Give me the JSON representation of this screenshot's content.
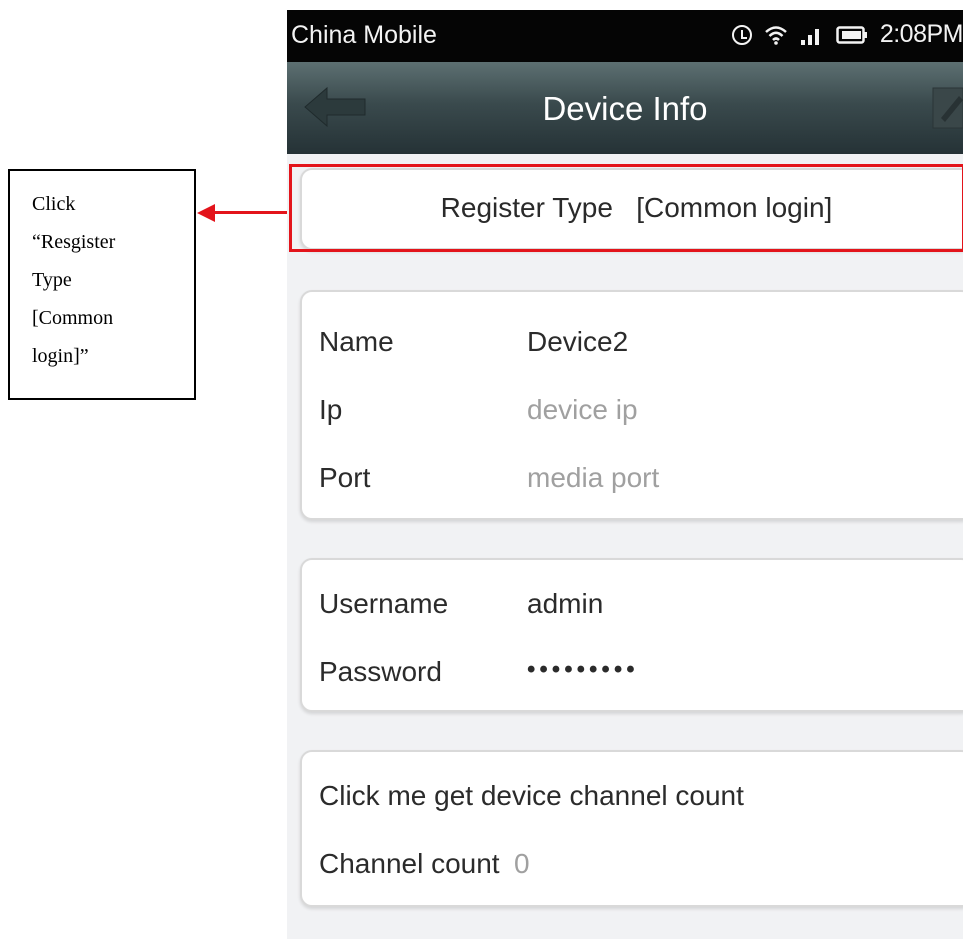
{
  "annotation": {
    "lines": [
      "Click",
      "“Resgister",
      "Type",
      "[Common",
      "login]”"
    ],
    "arrow_color": "#e3141b"
  },
  "statusbar": {
    "carrier": "China Mobile",
    "time": "2:08PM",
    "icons": [
      "alarm-icon",
      "wifi-icon",
      "signal-icon",
      "battery-icon"
    ]
  },
  "titlebar": {
    "title": "Device Info",
    "left_icon": "back-arrow-icon",
    "right_icon": "edit-icon"
  },
  "register": {
    "label": "Register Type",
    "value": "[Common login]",
    "text": "Register Type   [Common login]",
    "highlight_color": "#e3141b"
  },
  "device": {
    "name_label": "Name",
    "name_value": "Device2",
    "ip_label": "Ip",
    "ip_placeholder": "device ip",
    "port_label": "Port",
    "port_placeholder": "media port"
  },
  "credentials": {
    "username_label": "Username",
    "username_value": "admin",
    "password_label": "Password",
    "password_value": "•••••••••"
  },
  "channel": {
    "get_button": "Click me get device channel count",
    "count_label": "Channel count",
    "count_value": "0"
  }
}
